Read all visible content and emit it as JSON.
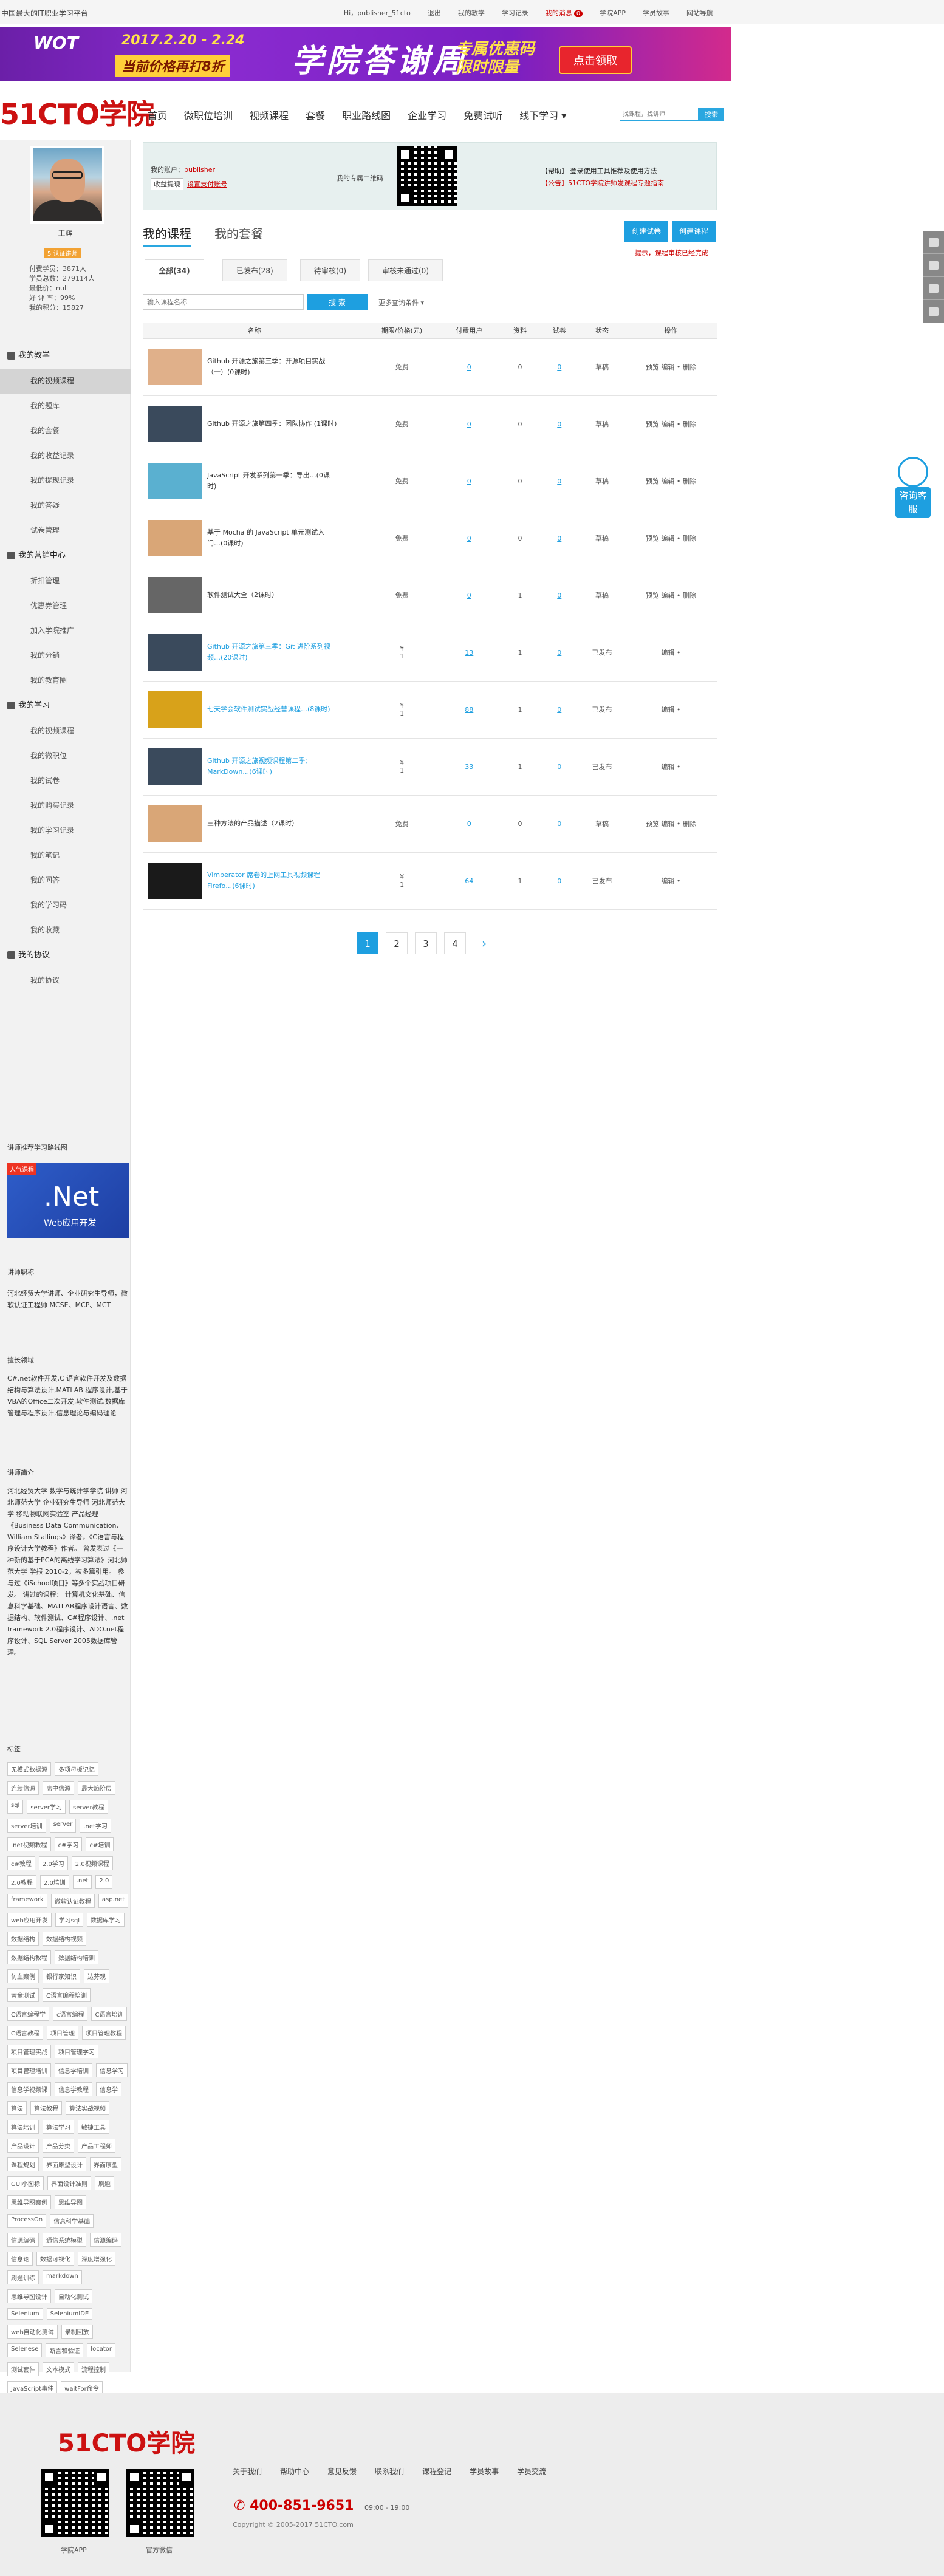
{
  "topbar": {
    "tagline": "中国最大的IT职业学习平台",
    "greeting": "Hi，",
    "username": "publisher_51cto",
    "links": [
      "退出",
      "我的教学",
      "学习记录"
    ],
    "message": "我的消息",
    "message_count": "0",
    "links2": [
      "学院APP",
      "学员故事",
      "网站导航"
    ]
  },
  "banner": {
    "logo": "WOT",
    "date": "2017.2.20 - 2.24",
    "sub": "当前价格再打8折",
    "big": "学院答谢周",
    "promo1": "专属优惠码",
    "promo2": "限时限量",
    "cta": "点击领取"
  },
  "header": {
    "logo": "51CTO学院",
    "nav": [
      "首页",
      "微职位培训",
      "视频课程",
      "套餐",
      "职业路线图",
      "企业学习",
      "免费试听",
      "线下学习"
    ],
    "search_placeholder": "找课程，找讲师",
    "search_button": "搜索"
  },
  "profile": {
    "name": "王辉",
    "badge": "5 认证讲师",
    "stats": [
      "付费学员：3871人",
      "学员总数：279114人",
      "最低价：null",
      "好 评 率：99%",
      "我的积分：15827"
    ]
  },
  "menu": [
    {
      "type": "grp",
      "label": "我的教学"
    },
    {
      "type": "it",
      "label": "我的视频课程",
      "active": true
    },
    {
      "type": "it",
      "label": "我的题库"
    },
    {
      "type": "it",
      "label": "我的套餐"
    },
    {
      "type": "it",
      "label": "我的收益记录"
    },
    {
      "type": "it",
      "label": "我的提现记录"
    },
    {
      "type": "it",
      "label": "我的答疑"
    },
    {
      "type": "it",
      "label": "试卷管理"
    },
    {
      "type": "grp",
      "label": "我的营销中心"
    },
    {
      "type": "it",
      "label": "折扣管理"
    },
    {
      "type": "it",
      "label": "优惠券管理"
    },
    {
      "type": "it",
      "label": "加入学院推广"
    },
    {
      "type": "it",
      "label": "我的分销"
    },
    {
      "type": "it",
      "label": "我的教育圈"
    },
    {
      "type": "grp",
      "label": "我的学习"
    },
    {
      "type": "it",
      "label": "我的视频课程"
    },
    {
      "type": "it",
      "label": "我的微职位"
    },
    {
      "type": "it",
      "label": "我的试卷"
    },
    {
      "type": "it",
      "label": "我的购买记录"
    },
    {
      "type": "it",
      "label": "我的学习记录"
    },
    {
      "type": "it",
      "label": "我的笔记"
    },
    {
      "type": "it",
      "label": "我的问答"
    },
    {
      "type": "it",
      "label": "我的学习码"
    },
    {
      "type": "it",
      "label": "我的收藏"
    },
    {
      "type": "grp",
      "label": "我的协议"
    },
    {
      "type": "it",
      "label": "我的协议"
    }
  ],
  "side": {
    "recommend_title": "讲师推荐学习路线图",
    "ad_corner": "人气课程",
    "ad_title": ".Net",
    "ad_sub": "Web应用开发",
    "job_title": "讲师职称",
    "job_text": "河北经贸大学讲师、企业研究生导师，微软认证工程师 MCSE、MCP、MCT",
    "area_title": "擅长领域",
    "area_text": "C#.net软件开发,C 语言软件开发及数据结构与算法设计,MATLAB 程序设计,基于VBA的Office二次开发,软件测试,数据库管理与程序设计,信息理论与编码理论",
    "intro_title": "讲师简介",
    "intro_text": "河北经贸大学 数学与统计学学院 讲师 河北师范大学 企业研究生导师 河北师范大学 移动物联网实验室 产品经理 《Business Data Communication, William Stallings》译者，《C语言与程序设计大学教程》作者。 曾发表过《一种新的基于PCA的离线学习算法》河北师范大学 学报 2010-2，被多篇引用。 参与过《iSchool项目》等多个实战项目研发。 讲过的课程： 计算机文化基础、信息科学基础、MATLAB程序设计语言、数据结构、软件测试、C#程序设计、.net framework 2.0程序设计、ADO.net程序设计、SQL Server 2005数据库管理。",
    "tags_title": "标签",
    "tags": [
      "无模式数据源",
      "多项母板记忆",
      "连续信源",
      "离中信源",
      "最大熵阶层",
      "sql",
      "server学习",
      "server教程",
      "server培训",
      "server",
      ".net学习",
      ".net视频教程",
      "c#学习",
      "c#培训",
      "c#教程",
      "2.0学习",
      "2.0视频课程",
      "2.0教程",
      "2.0培训",
      ".net",
      "2.0",
      "framework",
      "微软认证教程",
      "asp.net",
      "web应用开发",
      "学习sql",
      "数据库学习",
      "数据结构",
      "数据结构视频",
      "数据结构教程",
      "数据结构培训",
      "仿血案例",
      "银行家知识",
      "达芬观",
      "黄金测试",
      "C语言编程培训",
      "C语言编程学",
      "c语言编程",
      "C语言培训",
      "C语言教程",
      "项目管理",
      "项目管理教程",
      "项目管理实战",
      "项目管理学习",
      "项目管理培训",
      "信息学培训",
      "信息学习",
      "信息学视频课",
      "信息学教程",
      "信息学",
      "算法",
      "算法教程",
      "算法实战视频",
      "算法培训",
      "算法学习",
      "敏捷工具",
      "产品设计",
      "产品分类",
      "产品工程师",
      "课程规划",
      "界面原型设计",
      "界面原型",
      "GUI小图标",
      "界面设计准则",
      "刷题",
      "思维导图案例",
      "思维导图",
      "ProcessOn",
      "信息科学基础",
      "信源编码",
      "通信系统模型",
      "信源编码",
      "信息论",
      "数据可视化",
      "深度增强化",
      "刷题训练",
      "markdown",
      "思维导图设计",
      "自动化测试",
      "Selenium",
      "SeleniumIDE",
      "web自动化测试",
      "录制回放",
      "Selenese",
      "断言和验证",
      "locator",
      "测试套件",
      "文本模式",
      "流程控制",
      "JavaScript事件",
      "waitFor命令"
    ]
  },
  "info": {
    "account_label": "我的账户：",
    "account_user": "publisher",
    "bind_tag": "收益提现",
    "bind_link": "设置支付账号",
    "qr_label": "我的专属二维码",
    "notice1": "【帮助】 登录使用工具推荐及使用方法",
    "notice2": "【公告】51CTO学院讲师发课程专题指南"
  },
  "tabs": {
    "courses": "我的课程",
    "packages": "我的套餐",
    "btn_create": "创建试卷",
    "btn_course": "创建课程",
    "help": "提示，课程审核已经完成"
  },
  "subtabs": [
    "全部(34)",
    "已发布(28)",
    "待审核(0)",
    "审核未通过(0)"
  ],
  "filter": {
    "placeholder": "输入课程名称",
    "button": "搜 索",
    "more": "更多查询条件"
  },
  "table": {
    "headers": [
      "名称",
      "期限/价格(元)",
      "付费用户",
      "资料",
      "试卷",
      "状态",
      "操作"
    ],
    "rows": [
      {
        "title": "Github 开源之旅第三季：开源项目实战（一）(0课时)",
        "blue": false,
        "price": "免费",
        "users": "0",
        "res": "0",
        "exam": "0",
        "status": "草稿",
        "ops": "预览 编辑 • 删除",
        "thumb": "#e0b08a"
      },
      {
        "title": "Github 开源之旅第四季：团队协作 (1课时)",
        "blue": false,
        "price": "免费",
        "users": "0",
        "res": "0",
        "exam": "0",
        "status": "草稿",
        "ops": "预览 编辑 • 删除",
        "thumb": "#3a4a5c"
      },
      {
        "title": "JavaScript 开发系列第一季：导出…(0课时)",
        "blue": false,
        "price": "免费",
        "users": "0",
        "res": "0",
        "exam": "0",
        "status": "草稿",
        "ops": "预览 编辑 • 删除",
        "thumb": "#5ab0d0"
      },
      {
        "title": "基于 Mocha 的 JavaScript 单元测试入门…(0课时)",
        "blue": false,
        "price": "免费",
        "users": "0",
        "res": "0",
        "exam": "0",
        "status": "草稿",
        "ops": "预览 编辑 • 删除",
        "thumb": "#d9a677"
      },
      {
        "title": "软件测试大全（2课时）",
        "blue": false,
        "price": "免费",
        "users": "0",
        "res": "1",
        "exam": "0",
        "status": "草稿",
        "ops": "预览 编辑 • 删除",
        "thumb": "#666"
      },
      {
        "title": "Github 开源之旅第三季：Git 进阶系列视频…(20课时)",
        "blue": true,
        "price": "¥\n1",
        "users": "13",
        "res": "1",
        "exam": "0",
        "status": "已发布",
        "ops": "编辑 •",
        "thumb": "#3a4a5c"
      },
      {
        "title": "七天学会软件测试实战经营课程…(8课时)",
        "blue": true,
        "price": "¥\n1",
        "users": "88",
        "res": "1",
        "exam": "0",
        "status": "已发布",
        "ops": "编辑 •",
        "thumb": "#d8a21a"
      },
      {
        "title": "Github 开源之旅视频课程第二季：MarkDown…(6课时)",
        "blue": true,
        "price": "¥\n1",
        "users": "33",
        "res": "1",
        "exam": "0",
        "status": "已发布",
        "ops": "编辑 •",
        "thumb": "#3a4a5c"
      },
      {
        "title": "三种方法的产品描述（2课时）",
        "blue": false,
        "price": "免费",
        "users": "0",
        "res": "0",
        "exam": "0",
        "status": "草稿",
        "ops": "预览 编辑 • 删除",
        "thumb": "#d9a677"
      },
      {
        "title": "Vimperator 席卷的上网工具视频课程 Firefo…(6课时)",
        "blue": true,
        "price": "¥\n1",
        "users": "64",
        "res": "1",
        "exam": "0",
        "status": "已发布",
        "ops": "编辑 •",
        "thumb": "#1a1a1a"
      }
    ]
  },
  "pager": [
    "1",
    "2",
    "3",
    "4",
    "›"
  ],
  "service": "咨询客服",
  "footer": {
    "logo": "51CTO学院",
    "links": [
      "关于我们",
      "帮助中心",
      "意见反馈",
      "联系我们",
      "课程登记",
      "学员故事",
      "学员交流"
    ],
    "phone": "400-851-9651",
    "hours": "09:00 - 19:00",
    "copy": "Copyright © 2005-2017 51CTO.com",
    "q1": "学院APP",
    "q2": "官方微信"
  }
}
